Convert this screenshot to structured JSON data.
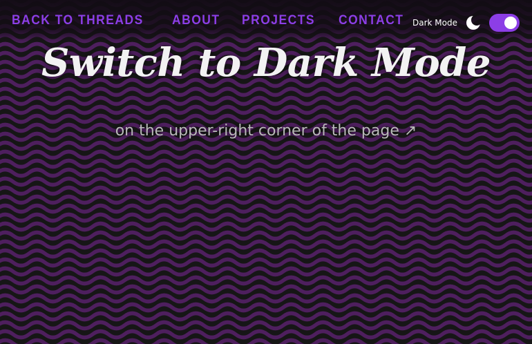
{
  "nav": {
    "links": [
      {
        "label": "BACK TO THREADS"
      },
      {
        "label": "ABOUT"
      },
      {
        "label": "PROJECTS"
      },
      {
        "label": "CONTACT"
      }
    ],
    "dark_mode": {
      "label": "Dark Mode",
      "icon": "moon-icon",
      "enabled": true
    }
  },
  "hero": {
    "title": "Switch to Dark Mode",
    "subtitle": "on the upper-right corner of the page ↗"
  },
  "colors": {
    "background": "#161616",
    "wave": "#4e1f5e",
    "accent": "#8c3ee6",
    "text": "#f2f2f2",
    "subtext": "#b9b9b9"
  }
}
